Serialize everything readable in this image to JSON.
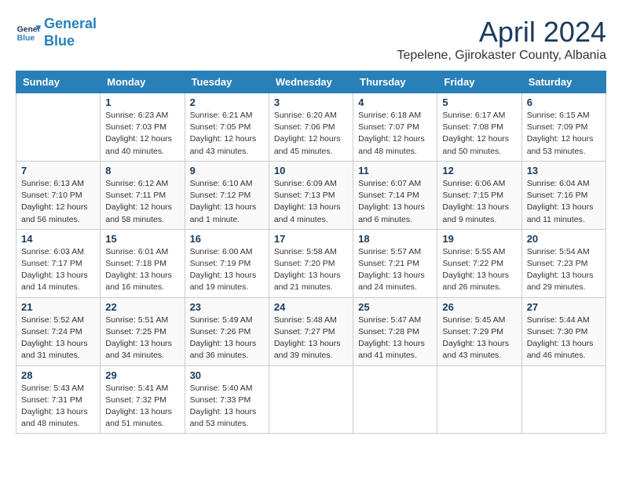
{
  "header": {
    "logo_line1": "General",
    "logo_line2": "Blue",
    "month_title": "April 2024",
    "subtitle": "Tepelene, Gjirokaster County, Albania"
  },
  "weekdays": [
    "Sunday",
    "Monday",
    "Tuesday",
    "Wednesday",
    "Thursday",
    "Friday",
    "Saturday"
  ],
  "weeks": [
    [
      {
        "day": "",
        "info": ""
      },
      {
        "day": "1",
        "info": "Sunrise: 6:23 AM\nSunset: 7:03 PM\nDaylight: 12 hours\nand 40 minutes."
      },
      {
        "day": "2",
        "info": "Sunrise: 6:21 AM\nSunset: 7:05 PM\nDaylight: 12 hours\nand 43 minutes."
      },
      {
        "day": "3",
        "info": "Sunrise: 6:20 AM\nSunset: 7:06 PM\nDaylight: 12 hours\nand 45 minutes."
      },
      {
        "day": "4",
        "info": "Sunrise: 6:18 AM\nSunset: 7:07 PM\nDaylight: 12 hours\nand 48 minutes."
      },
      {
        "day": "5",
        "info": "Sunrise: 6:17 AM\nSunset: 7:08 PM\nDaylight: 12 hours\nand 50 minutes."
      },
      {
        "day": "6",
        "info": "Sunrise: 6:15 AM\nSunset: 7:09 PM\nDaylight: 12 hours\nand 53 minutes."
      }
    ],
    [
      {
        "day": "7",
        "info": "Sunrise: 6:13 AM\nSunset: 7:10 PM\nDaylight: 12 hours\nand 56 minutes."
      },
      {
        "day": "8",
        "info": "Sunrise: 6:12 AM\nSunset: 7:11 PM\nDaylight: 12 hours\nand 58 minutes."
      },
      {
        "day": "9",
        "info": "Sunrise: 6:10 AM\nSunset: 7:12 PM\nDaylight: 13 hours\nand 1 minute."
      },
      {
        "day": "10",
        "info": "Sunrise: 6:09 AM\nSunset: 7:13 PM\nDaylight: 13 hours\nand 4 minutes."
      },
      {
        "day": "11",
        "info": "Sunrise: 6:07 AM\nSunset: 7:14 PM\nDaylight: 13 hours\nand 6 minutes."
      },
      {
        "day": "12",
        "info": "Sunrise: 6:06 AM\nSunset: 7:15 PM\nDaylight: 13 hours\nand 9 minutes."
      },
      {
        "day": "13",
        "info": "Sunrise: 6:04 AM\nSunset: 7:16 PM\nDaylight: 13 hours\nand 11 minutes."
      }
    ],
    [
      {
        "day": "14",
        "info": "Sunrise: 6:03 AM\nSunset: 7:17 PM\nDaylight: 13 hours\nand 14 minutes."
      },
      {
        "day": "15",
        "info": "Sunrise: 6:01 AM\nSunset: 7:18 PM\nDaylight: 13 hours\nand 16 minutes."
      },
      {
        "day": "16",
        "info": "Sunrise: 6:00 AM\nSunset: 7:19 PM\nDaylight: 13 hours\nand 19 minutes."
      },
      {
        "day": "17",
        "info": "Sunrise: 5:58 AM\nSunset: 7:20 PM\nDaylight: 13 hours\nand 21 minutes."
      },
      {
        "day": "18",
        "info": "Sunrise: 5:57 AM\nSunset: 7:21 PM\nDaylight: 13 hours\nand 24 minutes."
      },
      {
        "day": "19",
        "info": "Sunrise: 5:55 AM\nSunset: 7:22 PM\nDaylight: 13 hours\nand 26 minutes."
      },
      {
        "day": "20",
        "info": "Sunrise: 5:54 AM\nSunset: 7:23 PM\nDaylight: 13 hours\nand 29 minutes."
      }
    ],
    [
      {
        "day": "21",
        "info": "Sunrise: 5:52 AM\nSunset: 7:24 PM\nDaylight: 13 hours\nand 31 minutes."
      },
      {
        "day": "22",
        "info": "Sunrise: 5:51 AM\nSunset: 7:25 PM\nDaylight: 13 hours\nand 34 minutes."
      },
      {
        "day": "23",
        "info": "Sunrise: 5:49 AM\nSunset: 7:26 PM\nDaylight: 13 hours\nand 36 minutes."
      },
      {
        "day": "24",
        "info": "Sunrise: 5:48 AM\nSunset: 7:27 PM\nDaylight: 13 hours\nand 39 minutes."
      },
      {
        "day": "25",
        "info": "Sunrise: 5:47 AM\nSunset: 7:28 PM\nDaylight: 13 hours\nand 41 minutes."
      },
      {
        "day": "26",
        "info": "Sunrise: 5:45 AM\nSunset: 7:29 PM\nDaylight: 13 hours\nand 43 minutes."
      },
      {
        "day": "27",
        "info": "Sunrise: 5:44 AM\nSunset: 7:30 PM\nDaylight: 13 hours\nand 46 minutes."
      }
    ],
    [
      {
        "day": "28",
        "info": "Sunrise: 5:43 AM\nSunset: 7:31 PM\nDaylight: 13 hours\nand 48 minutes."
      },
      {
        "day": "29",
        "info": "Sunrise: 5:41 AM\nSunset: 7:32 PM\nDaylight: 13 hours\nand 51 minutes."
      },
      {
        "day": "30",
        "info": "Sunrise: 5:40 AM\nSunset: 7:33 PM\nDaylight: 13 hours\nand 53 minutes."
      },
      {
        "day": "",
        "info": ""
      },
      {
        "day": "",
        "info": ""
      },
      {
        "day": "",
        "info": ""
      },
      {
        "day": "",
        "info": ""
      }
    ]
  ]
}
